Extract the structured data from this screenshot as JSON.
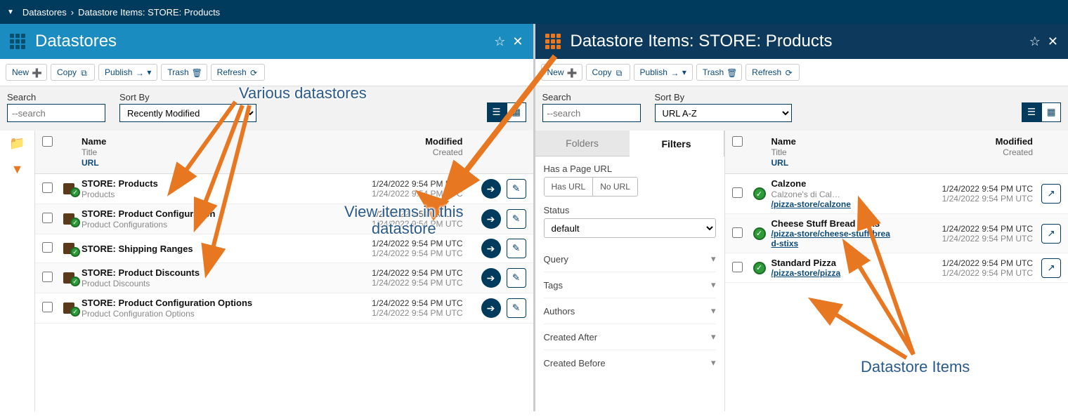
{
  "breadcrumb": {
    "caret": "▼",
    "items": [
      "Datastores",
      "Datastore Items: STORE: Products"
    ],
    "sep": "›"
  },
  "panels": {
    "left": {
      "title": "Datastores",
      "toolbar": {
        "new": "New",
        "copy": "Copy",
        "publish": "Publish",
        "trash": "Trash",
        "refresh": "Refresh"
      },
      "search": {
        "label": "Search",
        "placeholder": "--search"
      },
      "sort": {
        "label": "Sort By",
        "value": "Recently Modified"
      },
      "columns": {
        "name": "Name",
        "title": "Title",
        "url": "URL",
        "modified": "Modified",
        "created": "Created"
      },
      "rows": [
        {
          "name": "STORE: Products",
          "title": "Products",
          "modified": "1/24/2022 9:54 PM UTC",
          "created": "1/24/2022 9:54 PM UTC"
        },
        {
          "name": "STORE: Product Configuration",
          "title": "Product Configurations",
          "modified": "1/24/2022 9:54 PM UTC",
          "created": "1/24/2022 9:54 PM UTC"
        },
        {
          "name": "STORE: Shipping Ranges",
          "title": "",
          "modified": "1/24/2022 9:54 PM UTC",
          "created": "1/24/2022 9:54 PM UTC"
        },
        {
          "name": "STORE: Product Discounts",
          "title": "Product Discounts",
          "modified": "1/24/2022 9:54 PM UTC",
          "created": "1/24/2022 9:54 PM UTC"
        },
        {
          "name": "STORE: Product Configuration Options",
          "title": "Product Configuration Options",
          "modified": "1/24/2022 9:54 PM UTC",
          "created": "1/24/2022 9:54 PM UTC"
        }
      ]
    },
    "right": {
      "title": "Datastore Items: STORE: Products",
      "toolbar": {
        "new": "New",
        "copy": "Copy",
        "publish": "Publish",
        "trash": "Trash",
        "refresh": "Refresh"
      },
      "search": {
        "label": "Search",
        "placeholder": "--search"
      },
      "sort": {
        "label": "Sort By",
        "value": "URL A-Z"
      },
      "filter_tabs": {
        "folders": "Folders",
        "filters": "Filters"
      },
      "filters": {
        "hasPageUrl": {
          "label": "Has a Page URL",
          "hasUrl": "Has URL",
          "noUrl": "No URL"
        },
        "status": {
          "label": "Status",
          "value": "default"
        },
        "sections": [
          "Query",
          "Tags",
          "Authors",
          "Created After",
          "Created Before"
        ]
      },
      "columns": {
        "name": "Name",
        "title": "Title",
        "url": "URL",
        "modified": "Modified",
        "created": "Created"
      },
      "rows": [
        {
          "name": "Calzone",
          "title": "Calzone's di Cal…",
          "url": "/pizza-store/calzone",
          "modified": "1/24/2022 9:54 PM UTC",
          "created": "1/24/2022 9:54 PM UTC"
        },
        {
          "name": "Cheese Stuff Bread Stixs",
          "title": "",
          "url": "/pizza-store/cheese-stuff-bread-stixs",
          "modified": "1/24/2022 9:54 PM UTC",
          "created": "1/24/2022 9:54 PM UTC"
        },
        {
          "name": "Standard Pizza",
          "title": "",
          "url": "/pizza-store/pizza",
          "modified": "1/24/2022 9:54 PM UTC",
          "created": "1/24/2022 9:54 PM UTC"
        }
      ]
    }
  },
  "annotations": {
    "various": "Various datastores",
    "view_items": "View items in this\ndatastore",
    "ds_items": "Datastore Items"
  }
}
